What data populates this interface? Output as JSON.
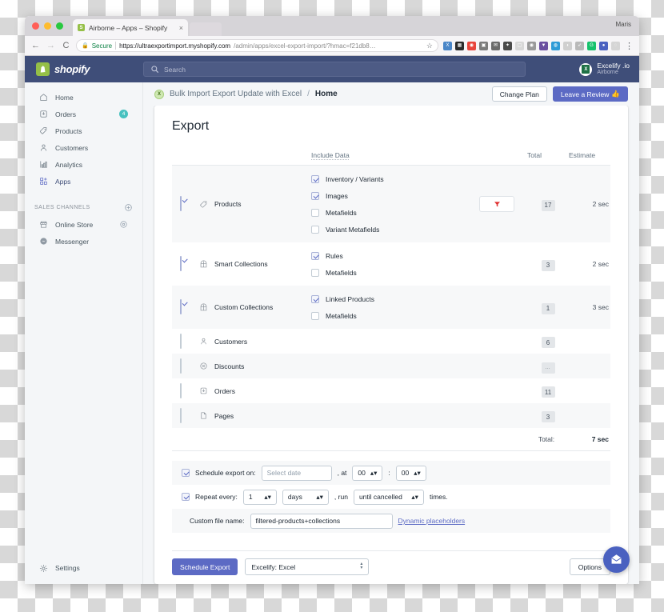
{
  "browser": {
    "tab_title": "Airborne – Apps – Shopify",
    "tab_close": "×",
    "os_user": "Maris",
    "back": "←",
    "forward": "→",
    "reload": "C",
    "secure_label": "Secure",
    "url_strong": "https://ultraexportimport.myshopify.com",
    "url_dim": "/admin/apps/excel-export-import/?hmac=f21db8…",
    "star": "☆",
    "menu": "⋮"
  },
  "topbar": {
    "brand": "shopify",
    "search_placeholder": "Search",
    "account_name": "Excelify .io",
    "account_store": "Airborne",
    "account_icon_text": "X"
  },
  "sidebar": {
    "items": [
      {
        "label": "Home",
        "icon": "home-icon",
        "badge": ""
      },
      {
        "label": "Orders",
        "icon": "orders-icon",
        "badge": "4"
      },
      {
        "label": "Products",
        "icon": "products-tag-icon",
        "badge": ""
      },
      {
        "label": "Customers",
        "icon": "customers-icon",
        "badge": ""
      },
      {
        "label": "Analytics",
        "icon": "analytics-icon",
        "badge": ""
      },
      {
        "label": "Apps",
        "icon": "apps-icon",
        "badge": ""
      }
    ],
    "section_title": "SALES CHANNELS",
    "channels": [
      {
        "label": "Online Store",
        "icon": "storefront-icon"
      },
      {
        "label": "Messenger",
        "icon": "messenger-icon"
      }
    ],
    "settings_label": "Settings"
  },
  "page_header": {
    "app_name": "Bulk Import Export Update with Excel",
    "separator": "/",
    "current": "Home",
    "change_plan": "Change Plan",
    "leave_review": "Leave a Review",
    "leave_review_emoji": "👍"
  },
  "export": {
    "title": "Export",
    "columns": {
      "include_data": "Include Data",
      "total": "Total",
      "estimate": "Estimate"
    },
    "rows": [
      {
        "name": "Products",
        "icon": "products-tag-icon",
        "checked": true,
        "sub": [
          {
            "label": "Inventory / Variants",
            "checked": true
          },
          {
            "label": "Images",
            "checked": true
          },
          {
            "label": "Metafields",
            "checked": false
          },
          {
            "label": "Variant Metafields",
            "checked": false
          }
        ],
        "has_filter": true,
        "total": "17",
        "estimate": "2 sec",
        "shaded": true
      },
      {
        "name": "Smart Collections",
        "icon": "collection-icon",
        "checked": true,
        "sub": [
          {
            "label": "Rules",
            "checked": true
          },
          {
            "label": "Metafields",
            "checked": false
          }
        ],
        "has_filter": false,
        "total": "3",
        "estimate": "2 sec",
        "shaded": false
      },
      {
        "name": "Custom Collections",
        "icon": "collection-icon",
        "checked": true,
        "sub": [
          {
            "label": "Linked Products",
            "checked": true
          },
          {
            "label": "Metafields",
            "checked": false
          }
        ],
        "has_filter": false,
        "total": "1",
        "estimate": "3 sec",
        "shaded": true
      },
      {
        "name": "Customers",
        "icon": "customers-icon",
        "checked": false,
        "sub": [],
        "has_filter": false,
        "total": "6",
        "estimate": "",
        "shaded": false
      },
      {
        "name": "Discounts",
        "icon": "discount-icon",
        "checked": false,
        "sub": [],
        "has_filter": false,
        "total": "…",
        "estimate": "",
        "shaded": true
      },
      {
        "name": "Orders",
        "icon": "orders-icon",
        "checked": false,
        "sub": [],
        "has_filter": false,
        "total": "11",
        "estimate": "",
        "shaded": false
      },
      {
        "name": "Pages",
        "icon": "page-icon",
        "checked": false,
        "sub": [],
        "has_filter": false,
        "total": "3",
        "estimate": "",
        "shaded": true
      }
    ],
    "total_label": "Total:",
    "total_value": "7 sec"
  },
  "schedule": {
    "export_on_checked": true,
    "export_on_label": "Schedule export on:",
    "date_placeholder": "Select date",
    "at_label": ", at",
    "hour": "00",
    "time_sep": ":",
    "minute": "00",
    "repeat_checked": true,
    "repeat_label": "Repeat every:",
    "repeat_count": "1",
    "repeat_unit": "days",
    "run_label": ", run",
    "run_value": "until cancelled",
    "times_label": "times.",
    "filename_label": "Custom file name:",
    "filename_value": "filtered-products+collections",
    "dynamic_placeholders": "Dynamic placeholders",
    "spinner_up": "▴",
    "spinner_down": "▾"
  },
  "footer": {
    "schedule_export": "Schedule Export",
    "format": "Excelify: Excel",
    "options": "Options"
  },
  "colors": {
    "shopify_nav": "#3f4e79",
    "primary": "#5c6ac4",
    "badge_teal": "#47c1bf",
    "filter_red": "#e03030",
    "shopify_green": "#95bf47",
    "chat_blue": "#4a61c0"
  }
}
